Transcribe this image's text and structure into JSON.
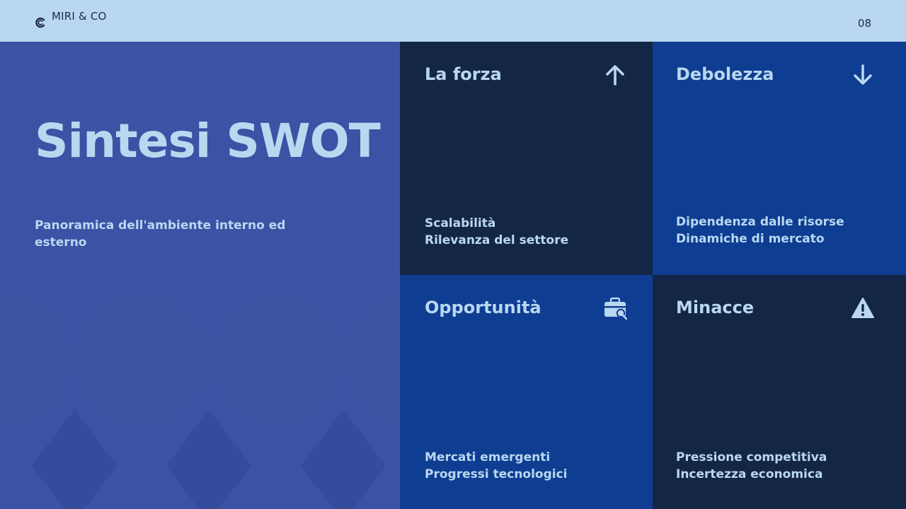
{
  "header": {
    "brand": "MIRI & CO",
    "page_number": "08"
  },
  "intro": {
    "title": "Sintesi SWOT",
    "subtitle": "Panoramica dell'ambiente interno ed esterno"
  },
  "swot": {
    "strength": {
      "title": "La forza",
      "icon": "arrow-up-icon",
      "items": [
        "Scalabilità",
        "Rilevanza del settore"
      ]
    },
    "weakness": {
      "title": "Debolezza",
      "icon": "arrow-down-icon",
      "items": [
        "Dipendenza dalle risorse",
        "Dinamiche di mercato"
      ]
    },
    "opportunity": {
      "title": "Opportunità",
      "icon": "briefcase-search-icon",
      "items": [
        "Mercati emergenti",
        "Progressi tecnologici"
      ]
    },
    "threat": {
      "title": "Minacce",
      "icon": "warning-triangle-icon",
      "items": [
        "Pressione competitiva",
        "Incertezza economica"
      ]
    }
  },
  "colors": {
    "topbar": "#b9d8f0",
    "left_panel": "#3a53a5",
    "dark_navy": "#142645",
    "royal_blue": "#0e3d92",
    "text_light": "#b9d8f0"
  }
}
